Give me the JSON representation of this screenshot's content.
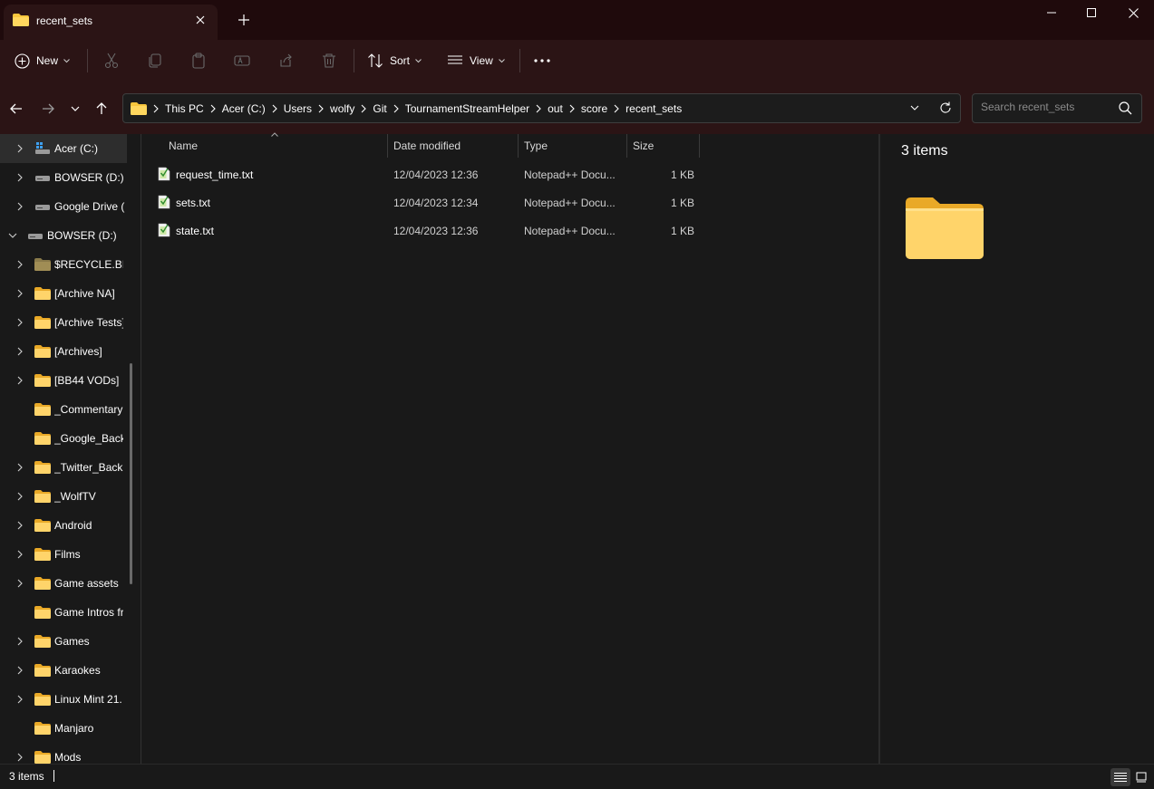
{
  "window": {
    "tab_title": "recent_sets"
  },
  "toolbar": {
    "new_label": "New",
    "sort_label": "Sort",
    "view_label": "View"
  },
  "address": {
    "crumbs": [
      "This PC",
      "Acer (C:)",
      "Users",
      "wolfy",
      "Git",
      "TournamentStreamHelper",
      "out",
      "score",
      "recent_sets"
    ]
  },
  "search": {
    "placeholder": "Search recent_sets"
  },
  "sidebar": {
    "items": [
      {
        "label": "Acer (C:)",
        "icon": "drive-windows-icon"
      },
      {
        "label": "BOWSER (D:)",
        "icon": "drive-icon"
      },
      {
        "label": "Google Drive (",
        "icon": "drive-icon"
      },
      {
        "label": "BOWSER (D:)",
        "icon": "drive-icon"
      },
      {
        "label": "$RECYCLE.BIN",
        "icon": "folder-icon"
      },
      {
        "label": "[Archive NA]",
        "icon": "folder-icon"
      },
      {
        "label": "[Archive Tests]",
        "icon": "folder-icon"
      },
      {
        "label": "[Archives]",
        "icon": "folder-icon"
      },
      {
        "label": "[BB44 VODs]",
        "icon": "folder-icon"
      },
      {
        "label": "_Commentary",
        "icon": "folder-icon"
      },
      {
        "label": "_Google_Backu",
        "icon": "folder-icon"
      },
      {
        "label": "_Twitter_Backu",
        "icon": "folder-icon"
      },
      {
        "label": "_WolfTV",
        "icon": "folder-icon"
      },
      {
        "label": "Android",
        "icon": "folder-icon"
      },
      {
        "label": "Films",
        "icon": "folder-icon"
      },
      {
        "label": "Game assets",
        "icon": "folder-icon"
      },
      {
        "label": "Game Intros fr",
        "icon": "folder-icon"
      },
      {
        "label": "Games",
        "icon": "folder-icon"
      },
      {
        "label": "Karaokes",
        "icon": "folder-icon"
      },
      {
        "label": "Linux Mint 21.",
        "icon": "folder-icon"
      },
      {
        "label": "Manjaro",
        "icon": "folder-icon"
      },
      {
        "label": "Mods",
        "icon": "folder-icon"
      }
    ]
  },
  "filelist": {
    "columns": [
      "Name",
      "Date modified",
      "Type",
      "Size"
    ],
    "rows": [
      {
        "name": "request_time.txt",
        "date": "12/04/2023 12:36",
        "type": "Notepad++ Docu...",
        "size": "1 KB"
      },
      {
        "name": "sets.txt",
        "date": "12/04/2023 12:34",
        "type": "Notepad++ Docu...",
        "size": "1 KB"
      },
      {
        "name": "state.txt",
        "date": "12/04/2023 12:36",
        "type": "Notepad++ Docu...",
        "size": "1 KB"
      }
    ]
  },
  "preview": {
    "count_text": "3 items"
  },
  "status": {
    "count_text": "3 items"
  },
  "colors": {
    "folder": "#f8c63d",
    "titlebar": "#1f0a0c",
    "chrome": "#2b1415",
    "background": "#191919"
  }
}
